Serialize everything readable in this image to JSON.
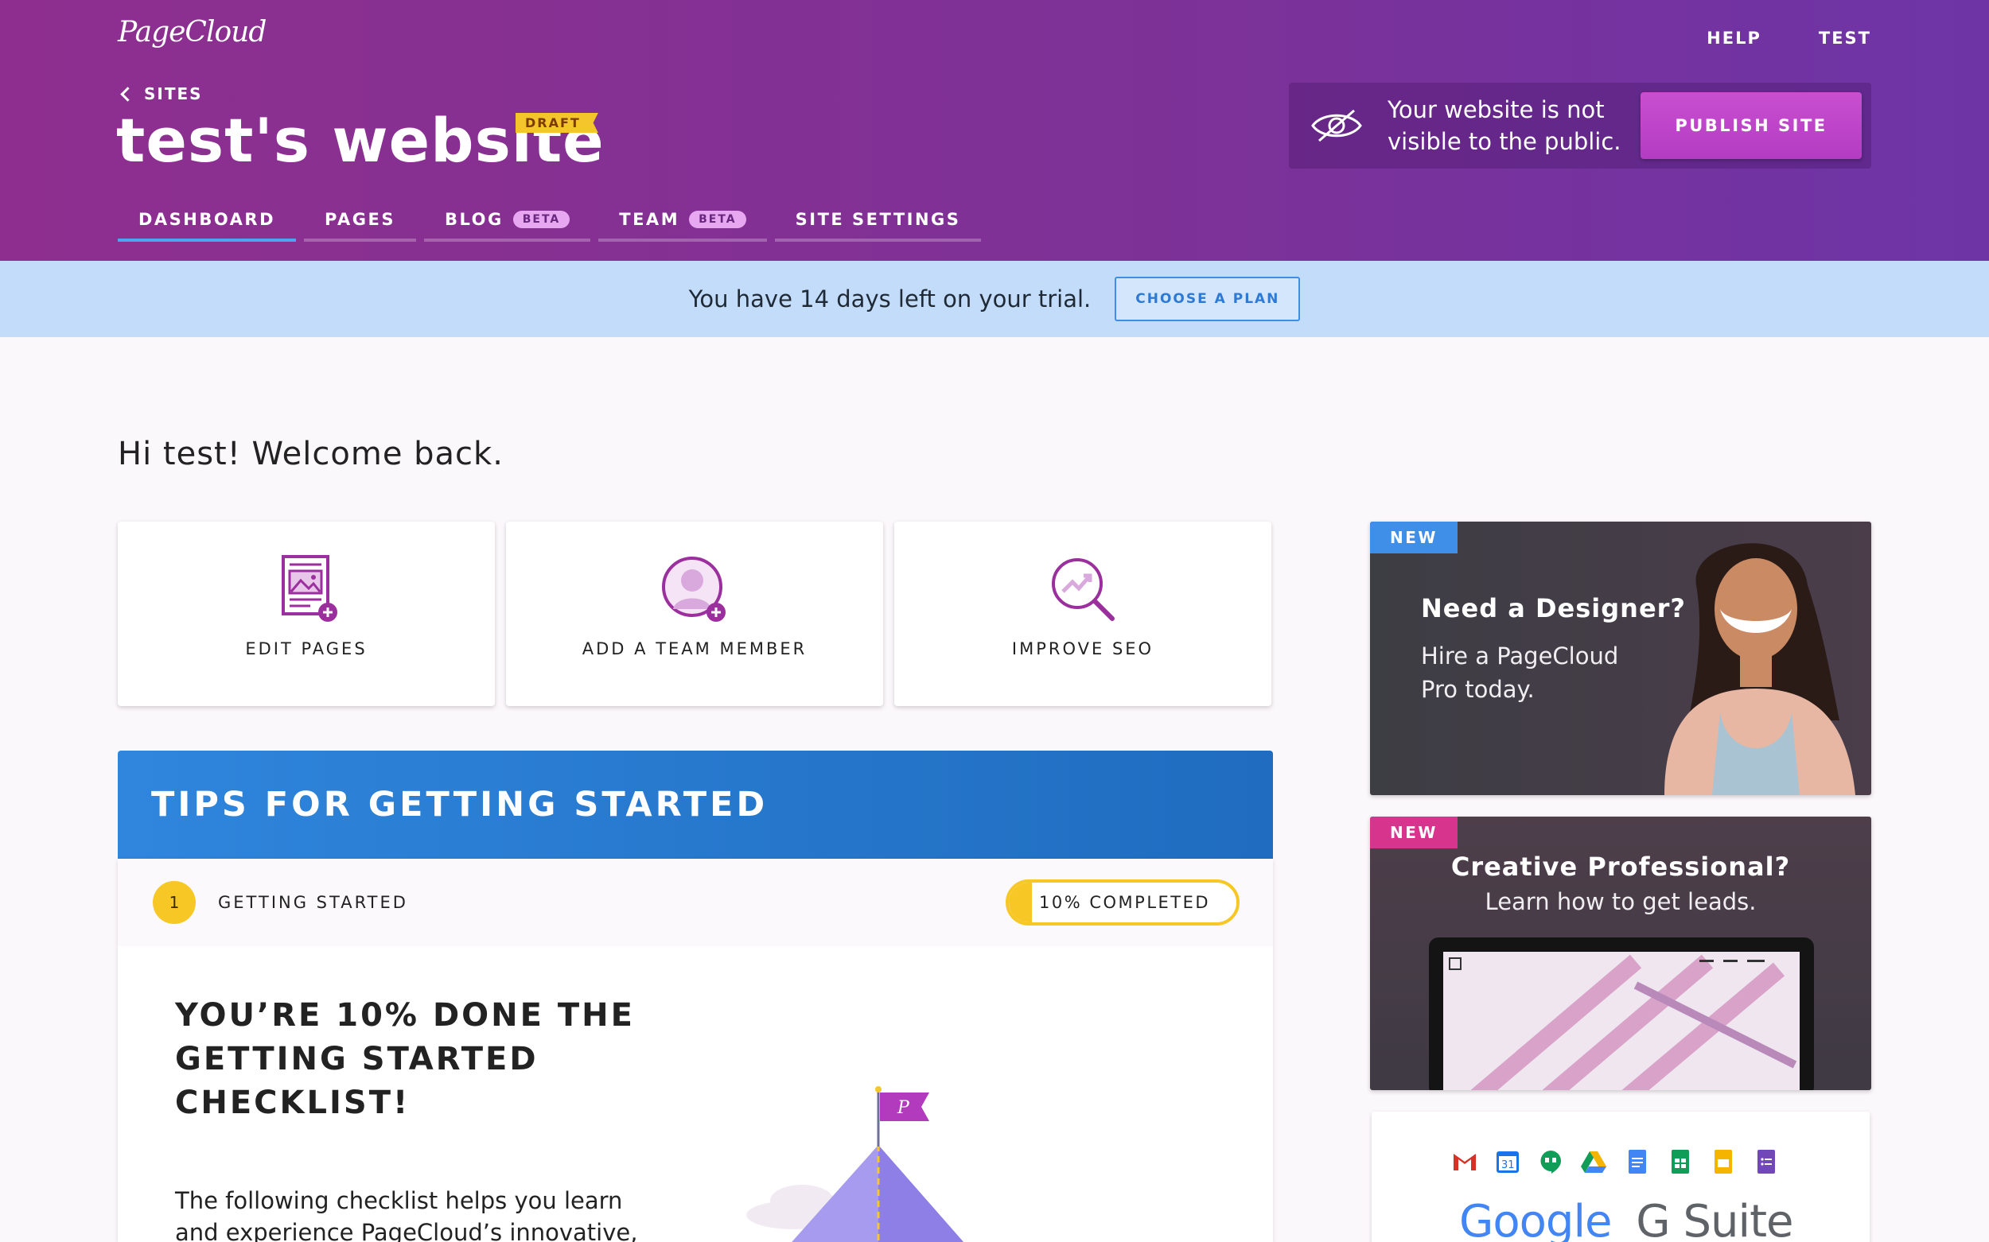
{
  "header": {
    "logo": "PageCloud",
    "top_links": [
      "HELP",
      "TEST"
    ],
    "back_label": "SITES",
    "site_title": "test's website",
    "draft_badge": "DRAFT",
    "tabs": [
      {
        "label": "DASHBOARD",
        "badge": null
      },
      {
        "label": "PAGES",
        "badge": null
      },
      {
        "label": "BLOG",
        "badge": "BETA"
      },
      {
        "label": "TEAM",
        "badge": "BETA"
      },
      {
        "label": "SITE SETTINGS",
        "badge": null
      }
    ],
    "visibility_text": "Your website is not visible to the public.",
    "publish_button": "PUBLISH SITE",
    "eye_icon": "eye-slash-icon"
  },
  "trial": {
    "text": "You have 14 days left on your trial.",
    "button": "CHOOSE A PLAN"
  },
  "welcome": "Hi test! Welcome back.",
  "quick_actions": [
    {
      "label": "EDIT PAGES",
      "icon": "page-image-plus-icon"
    },
    {
      "label": "ADD A TEAM MEMBER",
      "icon": "user-plus-icon"
    },
    {
      "label": "IMPROVE SEO",
      "icon": "magnifier-chart-icon"
    }
  ],
  "tips": {
    "title": "TIPS FOR GETTING STARTED",
    "step_number": "1",
    "step_label": "GETTING STARTED",
    "progress_label": "10% COMPLETED",
    "progress_fraction": 0.1,
    "done_title": "YOU’RE 10% DONE THE GETTING STARTED CHECKLIST!",
    "done_desc": "The following checklist helps you learn and experience PageCloud’s innovative,"
  },
  "promos": [
    {
      "badge": "NEW",
      "title": "Need a Designer?",
      "subtitle": "Hire a PageCloud Pro today."
    },
    {
      "badge": "NEW",
      "title": "Creative Professional?",
      "subtitle": "Learn how to get leads."
    }
  ],
  "gsuite": {
    "wordmark_left": "Google",
    "wordmark_right": "G Suite"
  },
  "colors": {
    "header_start": "#8e2f8f",
    "header_end": "#6e34a6",
    "publish": "#c94fd0",
    "trial_bg": "#c2dcfa",
    "tips_blue": "#2f86dc",
    "progress_yellow": "#f6c725",
    "accent_purple": "#9b2f9e"
  }
}
